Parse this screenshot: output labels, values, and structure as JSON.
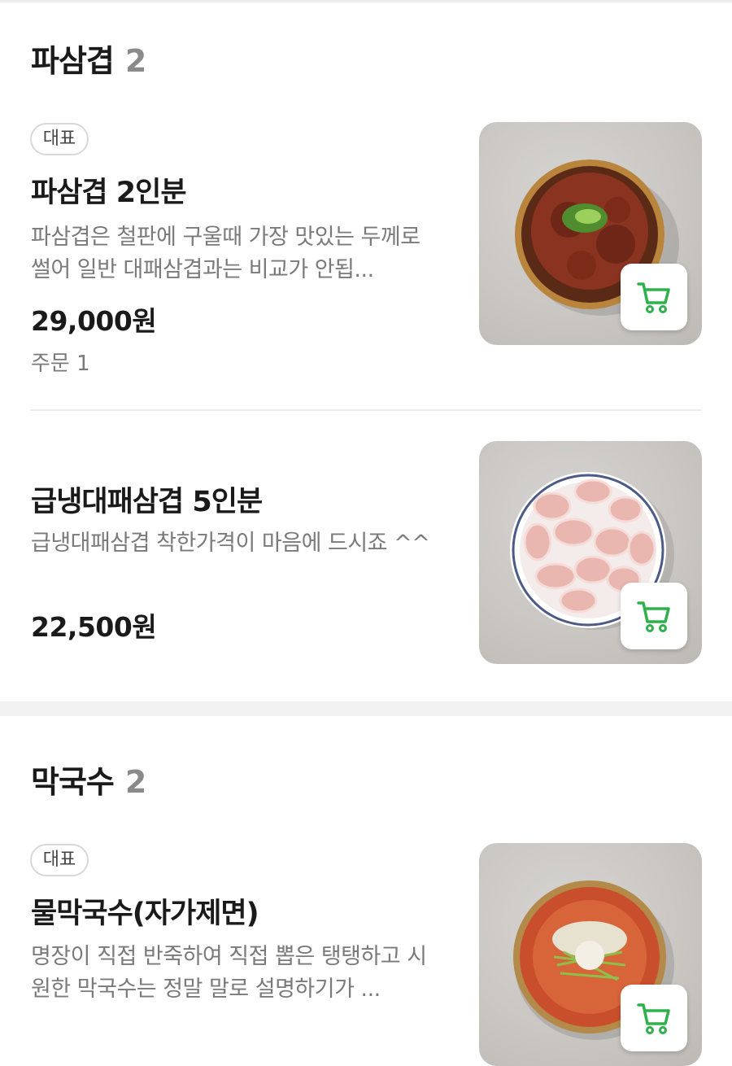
{
  "sections": [
    {
      "title": "파삼겹",
      "count": "2",
      "items": [
        {
          "badge": "대표",
          "name": "파삼겹 2인분",
          "description": "파삼겹은 철판에 구울때 가장 맛있는 두께로 썰어 일반 대패삼겹과는 비교가 안됩...",
          "price": "29,000원",
          "orders": "주문 1",
          "image": "bowl-of-spicy-pork-with-green-onion"
        },
        {
          "name": "급냉대패삼겹 5인분",
          "description": "급냉대패삼겹 착한가격이 마음에 드시죠 ^^",
          "price": "22,500원",
          "image": "plate-of-rolled-pork-belly-slices"
        }
      ]
    },
    {
      "title": "막국수",
      "count": "2",
      "items": [
        {
          "badge": "대표",
          "name": "물막국수(자가제면)",
          "description": "명장이 직접 반죽하여 직접 뽑은 탱탱하고 시원한 막국수는 정말 말로 설명하기가 ...",
          "image": "bowl-of-cold-buckwheat-noodles"
        }
      ]
    }
  ],
  "cart_icon": "cart-icon",
  "colors": {
    "cart_accent": "#2eb14a",
    "muted_text": "#7a7a7a",
    "count_text": "#8a8a8a"
  }
}
